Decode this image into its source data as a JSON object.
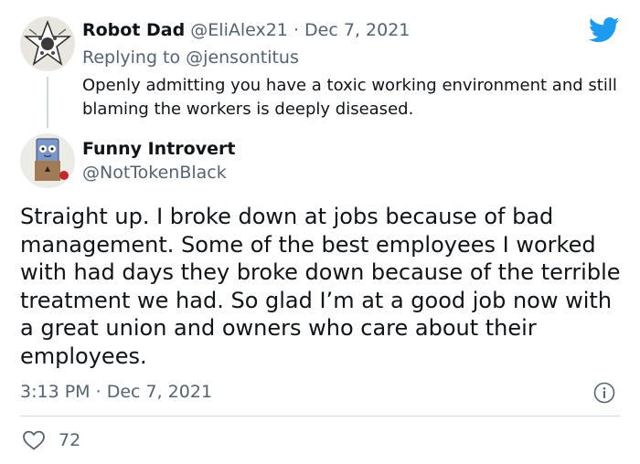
{
  "reply_tweet": {
    "author_name": "Robot Dad",
    "author_handle": "@EliAlex21",
    "separator": "·",
    "date": "Dec 7, 2021",
    "replying_prefix": "Replying to",
    "replying_to": "@jensontitus",
    "text": "Openly admitting you have a toxic working environment and still blaming the workers is deeply diseased."
  },
  "main_tweet": {
    "author_name": "Funny Introvert",
    "author_handle": "@NotTokenBlack",
    "text": "Straight up. I broke down at jobs because of  bad management. Some of the best employees I worked with had days they broke down because of the terrible treatment we had. So glad I’m at a good job now with a great union and owners who care about their employees.",
    "time": "3:13 PM",
    "separator": "·",
    "date": "Dec 7, 2021",
    "like_count": "72"
  },
  "icons": {
    "brand": "twitter-bird-icon",
    "info": "info-icon",
    "like": "heart-outline-icon"
  },
  "colors": {
    "brand_blue": "#1d9bf0",
    "text_primary": "#0f1419",
    "text_secondary": "#536471",
    "divider": "#cfd9de"
  }
}
